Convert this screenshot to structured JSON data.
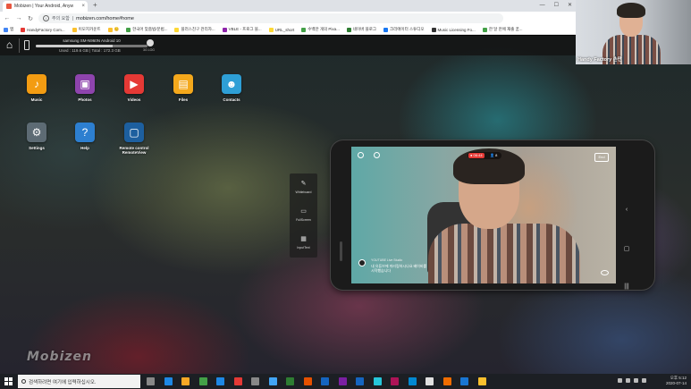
{
  "browser": {
    "tab_title": "Mobizen | Your Android, Anyw",
    "new_tab": "+",
    "window_controls": [
      "—",
      "☐",
      "✕"
    ],
    "security_label": "주의 요함",
    "url": "mobizen.com/home#home",
    "bookmarks": [
      {
        "label": "앱",
        "color": "#4285f4"
      },
      {
        "label": "HandyFactory Com...",
        "color": "#e53935"
      },
      {
        "label": "이모지카운트",
        "color": "#fbc02d"
      },
      {
        "label": "😊",
        "color": "#fbc02d"
      },
      {
        "label": "한국어 맞춤법/문법...",
        "color": "#43a047"
      },
      {
        "label": "플러스친구 관리자...",
        "color": "#fdd835"
      },
      {
        "label": "VBLE - 프로그 블...",
        "color": "#8e24aa"
      },
      {
        "label": "URL_short",
        "color": "#fdd835"
      },
      {
        "label": "수백만 개의 Pixa...",
        "color": "#43a047"
      },
      {
        "label": "네이버 블로그",
        "color": "#2e7d32"
      },
      {
        "label": "크리에이터 스튜디오",
        "color": "#1877f2"
      },
      {
        "label": "Music Licensing Fo...",
        "color": "#333333"
      },
      {
        "label": "한 달 만에 재출 꿈...",
        "color": "#43a047"
      }
    ]
  },
  "mobizen": {
    "device_name": "samsung SM-N960N  Android 10",
    "storage_text": "Used : 119.6 GB  |  Total : 172.3 GB",
    "storage_fraction": 0.69,
    "speed_text": "3G LOG",
    "apps": [
      {
        "label": "Music",
        "name": "music",
        "color": "#f39c12",
        "glyph": "♪"
      },
      {
        "label": "Photos",
        "name": "photos",
        "color": "#8e44ad",
        "glyph": "▣"
      },
      {
        "label": "Videos",
        "name": "videos",
        "color": "#e53935",
        "glyph": "▶"
      },
      {
        "label": "Files",
        "name": "files",
        "color": "#f4a81c",
        "glyph": "▤"
      },
      {
        "label": "Contacts",
        "name": "contacts",
        "color": "#2e9fd6",
        "glyph": "☻"
      },
      {
        "label": "Settings",
        "name": "settings",
        "color": "#5d6b74",
        "glyph": "⚙"
      },
      {
        "label": "Help",
        "name": "help",
        "color": "#2d7fd0",
        "glyph": "?"
      },
      {
        "label": "Remote control\nRemoteView",
        "name": "remote-control",
        "color": "#1d5f9f",
        "glyph": "▢"
      }
    ],
    "tools": [
      {
        "label": "Whiteboard",
        "glyph": "✎"
      },
      {
        "label": "FullScreen",
        "glyph": "▭"
      },
      {
        "label": "InputText",
        "glyph": "▦"
      }
    ],
    "stream": {
      "rec": "● 06:44",
      "viewers": "👤 8",
      "end": "End",
      "title": "YOUTUBE Live Studio",
      "comment_line1": "내 유튜브에 미러링하시나요 베이비를",
      "comment_line2": "시작했습니다"
    },
    "logo": "Mobizen"
  },
  "webcam": {
    "label": "Handy Factory 손만"
  },
  "taskbar": {
    "search_placeholder": "검색하려면 여기에 입력하십시오.",
    "time": "오후 5:12",
    "date": "2020-07-14",
    "pinned_colors": [
      "#888888",
      "#1e88e5",
      "#f9a825",
      "#43a047",
      "#1e88e5",
      "#e53935",
      "#888888",
      "#42a5f5",
      "#2e7d32",
      "#e65100",
      "#1565c0",
      "#7b1fa2",
      "#1565c0",
      "#26c6da",
      "#ad1457",
      "#0288d1",
      "#e0e0e0",
      "#ef6c00",
      "#1976d2",
      "#fbc02d"
    ]
  }
}
